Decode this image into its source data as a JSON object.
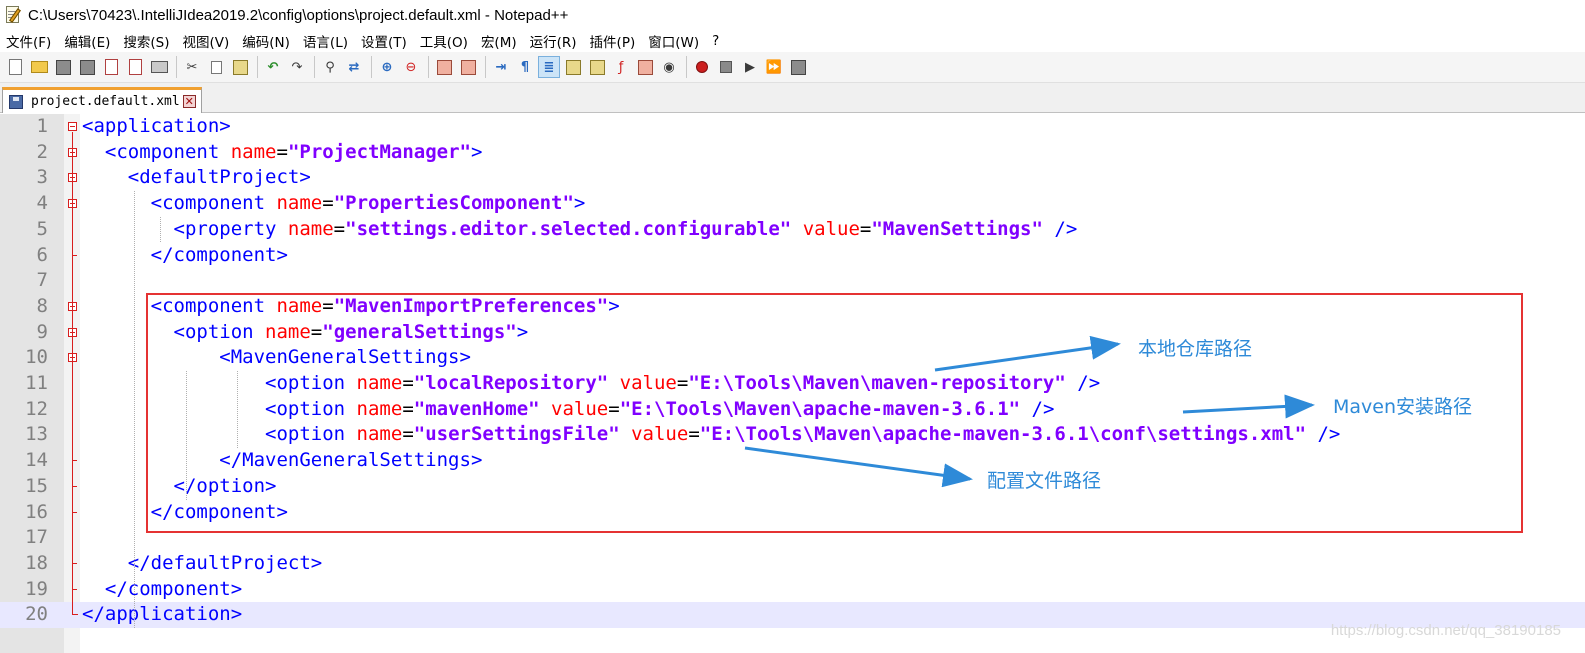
{
  "window": {
    "title": "C:\\Users\\70423\\.IntelliJIdea2019.2\\config\\options\\project.default.xml - Notepad++"
  },
  "menu": [
    "文件(F)",
    "编辑(E)",
    "搜索(S)",
    "视图(V)",
    "编码(N)",
    "语言(L)",
    "设置(T)",
    "工具(O)",
    "宏(M)",
    "运行(R)",
    "插件(P)",
    "窗口(W)",
    "?"
  ],
  "toolbar": {
    "buttons": [
      {
        "name": "new-file",
        "icon": "new-document-icon"
      },
      {
        "name": "open-file",
        "icon": "open-folder-icon"
      },
      {
        "name": "save",
        "icon": "save-icon"
      },
      {
        "name": "save-all",
        "icon": "save-all-icon"
      },
      {
        "name": "close",
        "icon": "close-file-icon"
      },
      {
        "name": "close-all",
        "icon": "close-all-icon"
      },
      {
        "name": "print",
        "icon": "print-icon"
      },
      {
        "name": "cut",
        "icon": "cut-icon"
      },
      {
        "name": "copy",
        "icon": "copy-icon"
      },
      {
        "name": "paste",
        "icon": "paste-icon"
      },
      {
        "name": "undo",
        "icon": "undo-icon"
      },
      {
        "name": "redo",
        "icon": "redo-icon"
      },
      {
        "name": "find",
        "icon": "find-icon"
      },
      {
        "name": "replace",
        "icon": "replace-icon"
      },
      {
        "name": "zoom-in",
        "icon": "zoom-in-icon"
      },
      {
        "name": "zoom-out",
        "icon": "zoom-out-icon"
      },
      {
        "name": "sync-vertical",
        "icon": "sync-vertical-icon"
      },
      {
        "name": "sync-horizontal",
        "icon": "sync-horizontal-icon"
      },
      {
        "name": "word-wrap",
        "icon": "word-wrap-icon"
      },
      {
        "name": "show-all-chars",
        "icon": "pilcrow-icon"
      },
      {
        "name": "indent-guide",
        "icon": "indent-guide-icon",
        "active": true
      },
      {
        "name": "user-language",
        "icon": "user-language-icon"
      },
      {
        "name": "document-map",
        "icon": "document-map-icon"
      },
      {
        "name": "function-list",
        "icon": "function-list-icon"
      },
      {
        "name": "folder-workspace",
        "icon": "folder-workspace-icon"
      },
      {
        "name": "monitoring",
        "icon": "eye-icon"
      },
      {
        "name": "record-macro",
        "icon": "record-icon"
      },
      {
        "name": "stop-macro",
        "icon": "stop-icon"
      },
      {
        "name": "play-macro",
        "icon": "play-icon"
      },
      {
        "name": "run-macro-multiple",
        "icon": "fast-forward-icon"
      },
      {
        "name": "save-macro",
        "icon": "save-macro-icon"
      }
    ]
  },
  "tab": {
    "label": "project.default.xml",
    "close_glyph": "✕"
  },
  "editor": {
    "lines": [
      {
        "n": "1",
        "indent": 0,
        "tokens": [
          {
            "t": "tag",
            "v": "<application>"
          }
        ]
      },
      {
        "n": "2",
        "indent": 2,
        "tokens": [
          {
            "t": "tag",
            "v": "<component "
          },
          {
            "t": "attr",
            "v": "name"
          },
          {
            "t": "eq",
            "v": "="
          },
          {
            "t": "val",
            "v": "\"ProjectManager\""
          },
          {
            "t": "tag",
            "v": ">"
          }
        ]
      },
      {
        "n": "3",
        "indent": 4,
        "tokens": [
          {
            "t": "tag",
            "v": "<defaultProject>"
          }
        ]
      },
      {
        "n": "4",
        "indent": 6,
        "tokens": [
          {
            "t": "tag",
            "v": "<component "
          },
          {
            "t": "attr",
            "v": "name"
          },
          {
            "t": "eq",
            "v": "="
          },
          {
            "t": "val",
            "v": "\"PropertiesComponent\""
          },
          {
            "t": "tag",
            "v": ">"
          }
        ]
      },
      {
        "n": "5",
        "indent": 8,
        "tokens": [
          {
            "t": "tag",
            "v": "<property "
          },
          {
            "t": "attr",
            "v": "name"
          },
          {
            "t": "eq",
            "v": "="
          },
          {
            "t": "val",
            "v": "\"settings.editor.selected.configurable\""
          },
          {
            "t": "attr",
            "v": " value"
          },
          {
            "t": "eq",
            "v": "="
          },
          {
            "t": "val",
            "v": "\"MavenSettings\""
          },
          {
            "t": "tag",
            "v": " />"
          }
        ]
      },
      {
        "n": "6",
        "indent": 6,
        "tokens": [
          {
            "t": "tag",
            "v": "</component>"
          }
        ]
      },
      {
        "n": "7",
        "indent": 0,
        "tokens": []
      },
      {
        "n": "8",
        "indent": 6,
        "tokens": [
          {
            "t": "tag",
            "v": "<component "
          },
          {
            "t": "attr",
            "v": "name"
          },
          {
            "t": "eq",
            "v": "="
          },
          {
            "t": "val",
            "v": "\"MavenImportPreferences\""
          },
          {
            "t": "tag",
            "v": ">"
          }
        ]
      },
      {
        "n": "9",
        "indent": 8,
        "tokens": [
          {
            "t": "tag",
            "v": "<option "
          },
          {
            "t": "attr",
            "v": "name"
          },
          {
            "t": "eq",
            "v": "="
          },
          {
            "t": "val",
            "v": "\"generalSettings\""
          },
          {
            "t": "tag",
            "v": ">"
          }
        ]
      },
      {
        "n": "10",
        "indent": 12,
        "tokens": [
          {
            "t": "tag",
            "v": "<MavenGeneralSettings>"
          }
        ]
      },
      {
        "n": "11",
        "indent": 16,
        "tokens": [
          {
            "t": "tag",
            "v": "<option "
          },
          {
            "t": "attr",
            "v": "name"
          },
          {
            "t": "eq",
            "v": "="
          },
          {
            "t": "val",
            "v": "\"localRepository\""
          },
          {
            "t": "attr",
            "v": " value"
          },
          {
            "t": "eq",
            "v": "="
          },
          {
            "t": "val",
            "v": "\"E:\\Tools\\Maven\\maven-repository\""
          },
          {
            "t": "tag",
            "v": " />"
          }
        ]
      },
      {
        "n": "12",
        "indent": 16,
        "tokens": [
          {
            "t": "tag",
            "v": "<option "
          },
          {
            "t": "attr",
            "v": "name"
          },
          {
            "t": "eq",
            "v": "="
          },
          {
            "t": "val",
            "v": "\"mavenHome\""
          },
          {
            "t": "attr",
            "v": " value"
          },
          {
            "t": "eq",
            "v": "="
          },
          {
            "t": "val",
            "v": "\"E:\\Tools\\Maven\\apache-maven-3.6.1\""
          },
          {
            "t": "tag",
            "v": " />"
          }
        ]
      },
      {
        "n": "13",
        "indent": 16,
        "tokens": [
          {
            "t": "tag",
            "v": "<option "
          },
          {
            "t": "attr",
            "v": "name"
          },
          {
            "t": "eq",
            "v": "="
          },
          {
            "t": "val",
            "v": "\"userSettingsFile\""
          },
          {
            "t": "attr",
            "v": " value"
          },
          {
            "t": "eq",
            "v": "="
          },
          {
            "t": "val",
            "v": "\"E:\\Tools\\Maven\\apache-maven-3.6.1\\conf\\settings.xml\""
          },
          {
            "t": "tag",
            "v": " />"
          }
        ]
      },
      {
        "n": "14",
        "indent": 12,
        "tokens": [
          {
            "t": "tag",
            "v": "</MavenGeneralSettings>"
          }
        ]
      },
      {
        "n": "15",
        "indent": 8,
        "tokens": [
          {
            "t": "tag",
            "v": "</option>"
          }
        ]
      },
      {
        "n": "16",
        "indent": 6,
        "tokens": [
          {
            "t": "tag",
            "v": "</component>"
          }
        ]
      },
      {
        "n": "17",
        "indent": 0,
        "tokens": []
      },
      {
        "n": "18",
        "indent": 4,
        "tokens": [
          {
            "t": "tag",
            "v": "</defaultProject>"
          }
        ]
      },
      {
        "n": "19",
        "indent": 2,
        "tokens": [
          {
            "t": "tag",
            "v": "</component>"
          }
        ]
      },
      {
        "n": "20",
        "indent": 0,
        "tokens": [
          {
            "t": "tag",
            "v": "</application>"
          }
        ]
      }
    ],
    "current_line": "20"
  },
  "annotations": {
    "local_repo": "本地仓库路径",
    "maven_home": "Maven安装路径",
    "settings_file": "配置文件路径"
  },
  "watermark": "https://blog.csdn.net/qq_38190185",
  "colors": {
    "tag": "#0000ff",
    "attr": "#ff0000",
    "value": "#8000ff",
    "highlight_box": "#e53232",
    "annotation": "#2e8ad8"
  }
}
